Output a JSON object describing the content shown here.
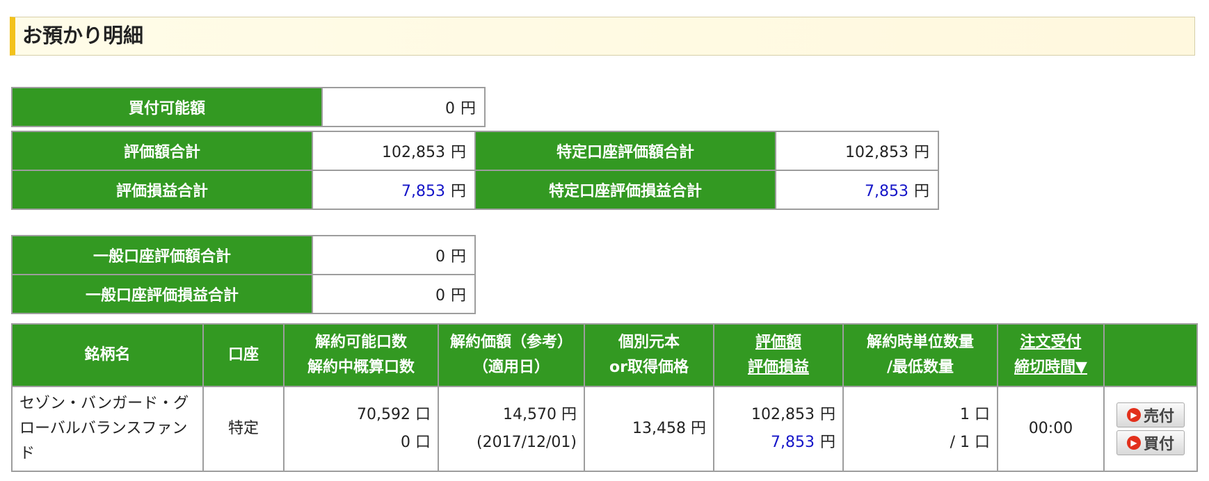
{
  "header": {
    "title": "お預かり明細"
  },
  "unit": "円",
  "summary_buy": {
    "label": "買付可能額",
    "value": "0"
  },
  "summary_total": {
    "eval_total_label": "評価額合計",
    "eval_total_value": "102,853",
    "tokutei_eval_label": "特定口座評価額合計",
    "tokutei_eval_value": "102,853",
    "pl_total_label": "評価損益合計",
    "pl_total_value": "7,853",
    "tokutei_pl_label": "特定口座評価損益合計",
    "tokutei_pl_value": "7,853"
  },
  "summary_ippan": {
    "eval_label": "一般口座評価額合計",
    "eval_value": "0",
    "pl_label": "一般口座評価損益合計",
    "pl_value": "0"
  },
  "holdings": {
    "headers": {
      "name": "銘柄名",
      "account": "口座",
      "units_1": "解約可能口数",
      "units_2": "解約中概算口数",
      "price_1": "解約価額（参考）",
      "price_2": "（適用日）",
      "cost_1": "個別元本",
      "cost_2": "or取得価格",
      "eval_1": "評価額",
      "eval_2": "評価損益",
      "unit_qty_1": "解約時単位数量",
      "unit_qty_2": "/最低数量",
      "deadline_1": "注文受付",
      "deadline_2": "締切時間▼"
    },
    "rows": [
      {
        "name": "セゾン・バンガード・グローバルバランスファンド",
        "account": "特定",
        "units_available": "70,592 口",
        "units_pending": "0 口",
        "nav_price": "14,570 円",
        "nav_date": "(2017/12/01)",
        "cost": "13,458 円",
        "eval_value": "102,853",
        "eval_pl": "7,853",
        "unit_qty": "1 口",
        "min_qty": "/ 1 口",
        "deadline": "00:00",
        "sell_label": "売付",
        "buy_label": "買付"
      }
    ]
  },
  "colors": {
    "header_green": "#339922",
    "value_blue": "#1515c8",
    "header_accent": "#f3c21b"
  }
}
